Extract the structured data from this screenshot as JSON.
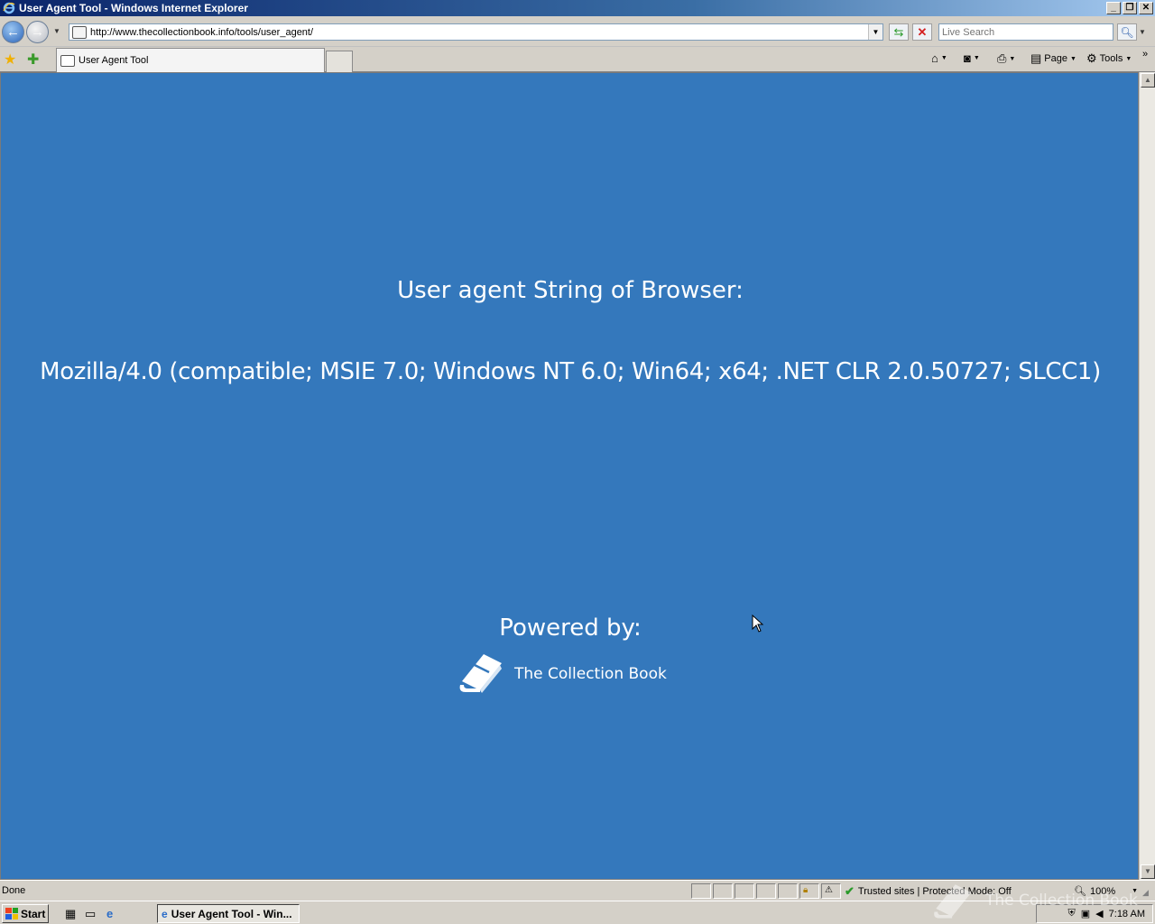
{
  "window": {
    "title": "User Agent Tool - Windows Internet Explorer"
  },
  "address_bar": {
    "url": "http://www.thecollectionbook.info/tools/user_agent/"
  },
  "search": {
    "placeholder": "Live Search"
  },
  "tabs": [
    {
      "label": "User Agent Tool",
      "active": true
    }
  ],
  "command_bar": {
    "page_label": "Page",
    "tools_label": "Tools"
  },
  "page": {
    "heading": "User agent String of Browser:",
    "user_agent": "Mozilla/4.0 (compatible; MSIE 7.0; Windows NT 6.0; Win64; x64; .NET CLR 2.0.50727; SLCC1)",
    "powered_by": "Powered by:",
    "brand_name": "The Collection Book",
    "background_color": "#3478bc"
  },
  "status_bar": {
    "status": "Done",
    "zone": "Trusted sites | Protected Mode: Off",
    "zoom": "100%"
  },
  "taskbar": {
    "start_label": "Start",
    "task_label": "User Agent Tool - Win...",
    "clock": "7:18 AM"
  },
  "watermark": "The Collection Book"
}
